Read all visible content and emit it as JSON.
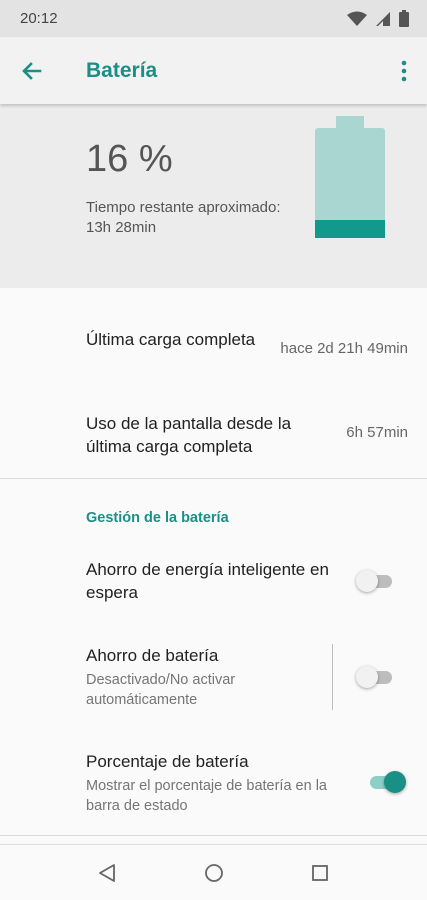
{
  "status_bar": {
    "time": "20:12",
    "icons": [
      "wifi-icon",
      "signal-icon",
      "battery-icon"
    ]
  },
  "app_bar": {
    "title": "Batería",
    "back_icon": "arrow-back-icon",
    "menu_icon": "more-vert-icon"
  },
  "battery": {
    "percent": "16 %",
    "level_fraction": 0.16,
    "remaining_line1": "Tiempo restante aproximado:",
    "remaining_line2": "13h 28min",
    "colors": {
      "body": "#aad6d2",
      "fill": "#11998c",
      "cap": "#aad6d2"
    }
  },
  "stats": [
    {
      "title": "Última carga completa",
      "value": "hace 2d 21h 49min"
    },
    {
      "title": "Uso de la pantalla desde la última carga completa",
      "value": "6h 57min"
    }
  ],
  "section": {
    "title": "Gestión de la batería"
  },
  "settings": [
    {
      "title": "Ahorro de energía inteligente en espera",
      "subtitle": "",
      "enabled": false
    },
    {
      "title": "Ahorro de batería",
      "subtitle": "Desactivado/No activar automáticamente",
      "enabled": false
    },
    {
      "title": "Porcentaje de batería",
      "subtitle": "Mostrar el porcentaje de batería en la barra de estado",
      "enabled": true
    }
  ],
  "nav_bar": {
    "icons": [
      "back-triangle-icon",
      "home-circle-icon",
      "recents-square-icon"
    ]
  },
  "colors": {
    "accent": "#1a8f85"
  }
}
